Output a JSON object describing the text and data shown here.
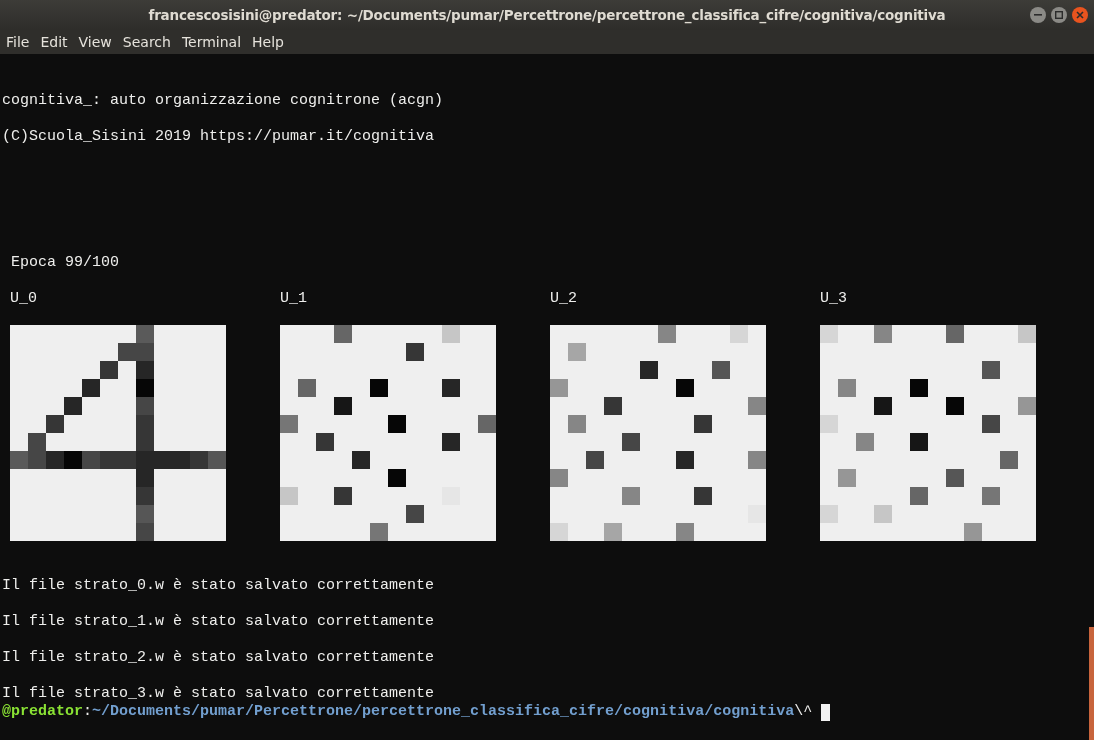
{
  "window": {
    "title": "francescosisini@predator: ~/Documents/pumar/Percettrone/percettrone_classifica_cifre/cognitiva/cognitiva"
  },
  "menu": [
    "File",
    "Edit",
    "View",
    "Search",
    "Terminal",
    "Help"
  ],
  "header_lines": [
    "cognitiva_: auto organizzazione cognitrone (acgn)",
    "(C)Scuola_Sisini 2019 https://pumar.it/cognitiva"
  ],
  "epoch": "Epoca 99/100",
  "panels": [
    {
      "label": "U_0"
    },
    {
      "label": "U_1"
    },
    {
      "label": "U_2"
    },
    {
      "label": "U_3"
    }
  ],
  "footer_lines": [
    "Il file strato_0.w è stato salvato correttamente",
    "Il file strato_1.w è stato salvato correttamente",
    "Il file strato_2.w è stato salvato correttamente",
    "Il file strato_3.w è stato salvato correttamente"
  ],
  "prompt": {
    "host": "@predator",
    "separator": ":",
    "path": "~/Documents/pumar/Percettrone/percettrone_classifica_cifre/cognitiva/cognitiva",
    "input": "\\^"
  }
}
